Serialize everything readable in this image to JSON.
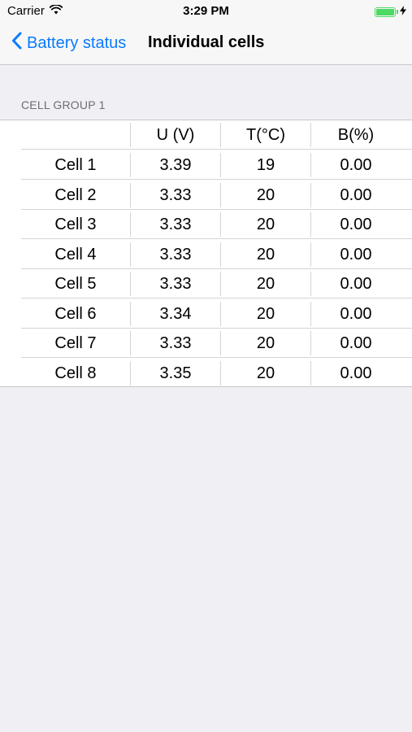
{
  "status_bar": {
    "carrier": "Carrier",
    "time": "3:29 PM",
    "battery_level": 1.0
  },
  "nav": {
    "back_label": "Battery status",
    "title": "Individual cells"
  },
  "section_header": "CELL GROUP 1",
  "table": {
    "columns": [
      "",
      "U (V)",
      "T(°C)",
      "B(%)"
    ],
    "rows": [
      [
        "Cell 1",
        "3.39",
        "19",
        "0.00"
      ],
      [
        "Cell 2",
        "3.33",
        "20",
        "0.00"
      ],
      [
        "Cell 3",
        "3.33",
        "20",
        "0.00"
      ],
      [
        "Cell 4",
        "3.33",
        "20",
        "0.00"
      ],
      [
        "Cell 5",
        "3.33",
        "20",
        "0.00"
      ],
      [
        "Cell 6",
        "3.34",
        "20",
        "0.00"
      ],
      [
        "Cell 7",
        "3.33",
        "20",
        "0.00"
      ],
      [
        "Cell 8",
        "3.35",
        "20",
        "0.00"
      ]
    ]
  },
  "colors": {
    "accent": "#0a7aff",
    "battery": "#4cd964",
    "background": "#efeff4"
  },
  "icons": {
    "back": "chevron-left-icon",
    "wifi": "wifi-icon",
    "battery": "battery-icon",
    "charging": "charging-bolt-icon"
  }
}
